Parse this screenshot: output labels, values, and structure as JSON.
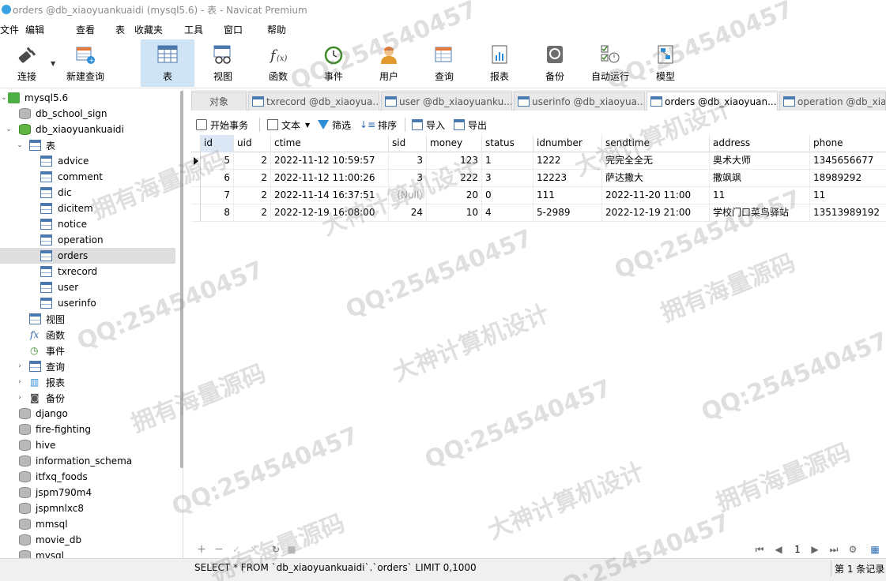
{
  "window": {
    "title": "orders @db_xiaoyuankuaidi (mysql5.6) - 表 - Navicat Premium"
  },
  "menu": [
    "文件",
    "编辑",
    "查看",
    "表",
    "收藏夹",
    "工具",
    "窗口",
    "帮助"
  ],
  "toolbar": {
    "buttons": [
      {
        "label": "连接",
        "icon": "plug-icon"
      },
      {
        "label": "新建查询",
        "icon": "new-query-icon"
      },
      {
        "label": "表",
        "icon": "table-icon"
      },
      {
        "label": "视图",
        "icon": "view-icon"
      },
      {
        "label": "函数",
        "icon": "function-icon"
      },
      {
        "label": "事件",
        "icon": "clock-icon"
      },
      {
        "label": "用户",
        "icon": "user-icon"
      },
      {
        "label": "查询",
        "icon": "query-icon"
      },
      {
        "label": "报表",
        "icon": "report-icon"
      },
      {
        "label": "备份",
        "icon": "backup-icon"
      },
      {
        "label": "自动运行",
        "icon": "schedule-icon"
      },
      {
        "label": "模型",
        "icon": "model-icon"
      }
    ]
  },
  "sidebar": {
    "connection": "mysql5.6",
    "databases_before": [
      "db_school_sign"
    ],
    "open_db": "db_xiaoyuankuaidi",
    "tables_label": "表",
    "tables": [
      "advice",
      "comment",
      "dic",
      "dicitem",
      "notice",
      "operation",
      "orders",
      "txrecord",
      "user",
      "userinfo"
    ],
    "selected_table": "orders",
    "groups": [
      "视图",
      "函数",
      "事件",
      "查询",
      "报表",
      "备份"
    ],
    "databases_after": [
      "django",
      "fire-fighting",
      "hive",
      "information_schema",
      "itfxq_foods",
      "jspm790m4",
      "jspmnlxc8",
      "mmsql",
      "movie_db",
      "mysql"
    ]
  },
  "tabs": [
    {
      "label": "对象"
    },
    {
      "label": "txrecord @db_xiaoyua..."
    },
    {
      "label": "user @db_xiaoyuanku..."
    },
    {
      "label": "userinfo @db_xiaoyua..."
    },
    {
      "label": "orders @db_xiaoyuan..."
    },
    {
      "label": "operation @db_xiao"
    }
  ],
  "subtoolbar": {
    "begin_transaction": "开始事务",
    "text": "文本",
    "filter": "筛选",
    "sort": "排序",
    "import": "导入",
    "export": "导出"
  },
  "grid": {
    "columns": [
      "id",
      "uid",
      "ctime",
      "sid",
      "money",
      "status",
      "idnumber",
      "sendtime",
      "address",
      "phone"
    ],
    "rows": [
      [
        "5",
        "2",
        "2022-11-12 10:59:57",
        "3",
        "123",
        "1",
        "1222",
        "完完全全无",
        "奥术大师",
        "1345656677"
      ],
      [
        "6",
        "2",
        "2022-11-12 11:00:26",
        "3",
        "222",
        "3",
        "12223",
        "萨达撒大",
        "撒飒飒",
        "18989292"
      ],
      [
        "7",
        "2",
        "2022-11-14 16:37:51",
        "(Null)",
        "20",
        "0",
        "111",
        "2022-11-20  11:00",
        "11",
        "11"
      ],
      [
        "8",
        "2",
        "2022-12-19 16:08:00",
        "24",
        "10",
        "4",
        "5-2989",
        "2022-12-19  21:00",
        "学校门口菜鸟驿站",
        "13513989192"
      ]
    ]
  },
  "nav": {
    "page": "1"
  },
  "status": {
    "sql": "SELECT * FROM `db_xiaoyuankuaidi`.`orders` LIMIT 0,1000",
    "records": "第 1 条记录"
  },
  "watermarks": [
    "QQ:254540457",
    "拥有海量源码",
    "大神计算机设计"
  ],
  "colors": {
    "active_toolbar": "#cfe4f5",
    "selection": "#dedede",
    "accent": "#4a79b0"
  }
}
